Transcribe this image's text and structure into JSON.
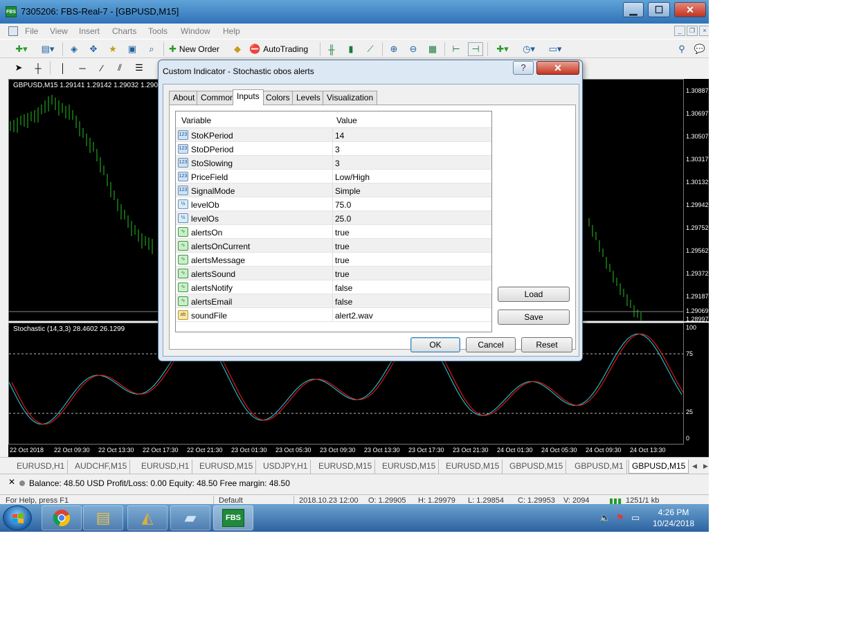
{
  "window": {
    "title": "7305206: FBS-Real-7 - [GBPUSD,M15]",
    "icon_text": "FBS",
    "controls": {
      "minimize": "▁",
      "maximize": "☐",
      "close": "✕"
    }
  },
  "menu": {
    "items": [
      "File",
      "View",
      "Insert",
      "Charts",
      "Tools",
      "Window",
      "Help"
    ]
  },
  "toolbar": {
    "new_order": "New Order",
    "autotrading": "AutoTrading"
  },
  "chart": {
    "header": "GBPUSD,M15  1.29141 1.29142 1.29032 1.290",
    "price_ticks": [
      "1.30887",
      "1.30697",
      "1.30507",
      "1.30317",
      "1.30132",
      "1.29942",
      "1.29752",
      "1.29562",
      "1.29372",
      "1.29187",
      "1.29069",
      "1.28997"
    ],
    "stochastic_header": "Stochastic (14,3,3) 28.4602 26.1299",
    "stochastic_ticks": [
      "100",
      "75",
      "25",
      "0"
    ],
    "time_ticks": [
      "22 Oct 2018",
      "22 Oct 09:30",
      "22 Oct 13:30",
      "22 Oct 17:30",
      "22 Oct 21:30",
      "23 Oct 01:30",
      "23 Oct 05:30",
      "23 Oct 09:30",
      "23 Oct 13:30",
      "23 Oct 17:30",
      "23 Oct 21:30",
      "24 Oct 01:30",
      "24 Oct 05:30",
      "24 Oct 09:30",
      "24 Oct 13:30"
    ],
    "colors": {
      "candles": "#22c322",
      "main_line": "#20b8c8",
      "signal_line": "#e01818",
      "background": "#000000"
    }
  },
  "chart_tabs": [
    "EURUSD,H1",
    "AUDCHF,M15",
    "EURUSD,H1",
    "EURUSD,M15",
    "USDJPY,H1",
    "EURUSD,M15",
    "EURUSD,M15",
    "EURUSD,M15",
    "GBPUSD,M15",
    "GBPUSD,M1",
    "GBPUSD,M15"
  ],
  "terminal": {
    "close": "✕",
    "balance_line": "Balance: 48.50 USD  Profit/Loss: 0.00  Equity: 48.50  Free margin: 48.50"
  },
  "statusbar": {
    "help": "For Help, press F1",
    "profile": "Default",
    "datetime": "2018.10.23 12:00",
    "open": "O: 1.29905",
    "high": "H: 1.29979",
    "low": "L: 1.29854",
    "close": "C: 1.29953",
    "volume": "V: 2094",
    "traffic": "1251/1 kb"
  },
  "taskbar": {
    "clock_time": "4:26 PM",
    "clock_date": "10/24/2018",
    "fbs_label": "FBS"
  },
  "dialog": {
    "title": "Custom Indicator - Stochastic obos alerts",
    "help": "?",
    "close": "✕",
    "tabs": [
      "About",
      "Common",
      "Inputs",
      "Colors",
      "Levels",
      "Visualization"
    ],
    "active_tab": "Inputs",
    "columns": {
      "variable": "Variable",
      "value": "Value"
    },
    "params": [
      {
        "type": "int",
        "icon": "123",
        "name": "StoKPeriod",
        "value": "14"
      },
      {
        "type": "int",
        "icon": "123",
        "name": "StoDPeriod",
        "value": "3"
      },
      {
        "type": "int",
        "icon": "123",
        "name": "StoSlowing",
        "value": "3"
      },
      {
        "type": "int",
        "icon": "123",
        "name": "PriceField",
        "value": "Low/High"
      },
      {
        "type": "int",
        "icon": "123",
        "name": "SignalMode",
        "value": "Simple"
      },
      {
        "type": "double",
        "icon": "½",
        "name": "levelOb",
        "value": "75.0"
      },
      {
        "type": "double",
        "icon": "½",
        "name": "levelOs",
        "value": "25.0"
      },
      {
        "type": "bool",
        "icon": "∿",
        "name": "alertsOn",
        "value": "true"
      },
      {
        "type": "bool",
        "icon": "∿",
        "name": "alertsOnCurrent",
        "value": "true"
      },
      {
        "type": "bool",
        "icon": "∿",
        "name": "alertsMessage",
        "value": "true"
      },
      {
        "type": "bool",
        "icon": "∿",
        "name": "alertsSound",
        "value": "true"
      },
      {
        "type": "bool",
        "icon": "∿",
        "name": "alertsNotify",
        "value": "false"
      },
      {
        "type": "bool",
        "icon": "∿",
        "name": "alertsEmail",
        "value": "false"
      },
      {
        "type": "string",
        "icon": "ab",
        "name": "soundFile",
        "value": "alert2.wav"
      }
    ],
    "buttons": {
      "load": "Load",
      "save": "Save",
      "ok": "OK",
      "cancel": "Cancel",
      "reset": "Reset"
    }
  }
}
